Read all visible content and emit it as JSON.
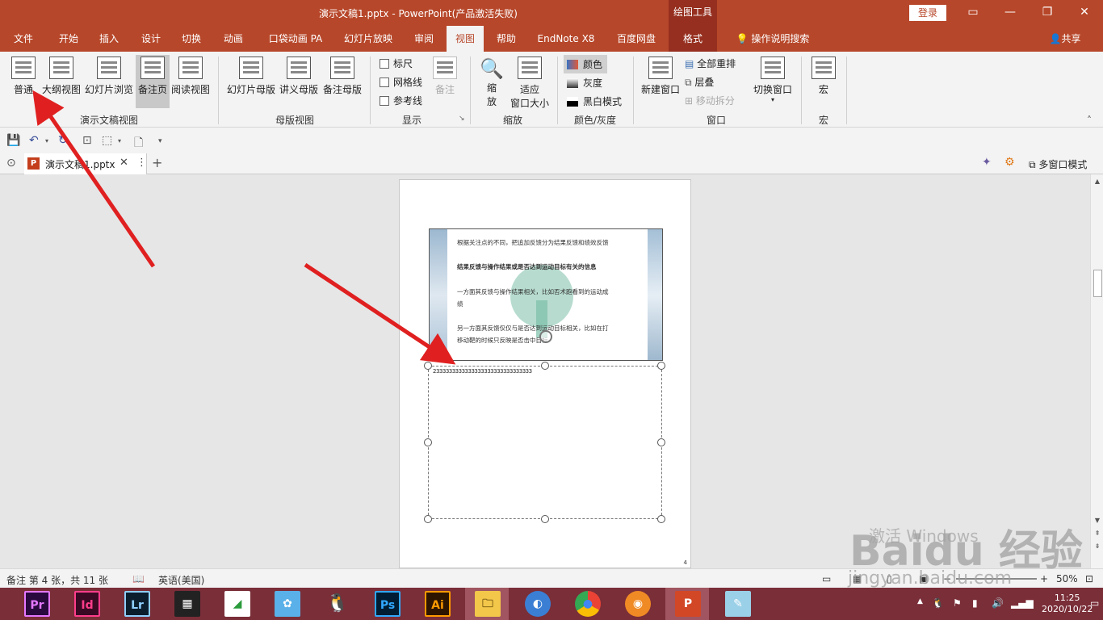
{
  "titlebar": {
    "title": "演示文稿1.pptx  -  PowerPoint(产品激活失败)",
    "drawing_tools": "绘图工具",
    "login": "登录"
  },
  "tabs": [
    "文件",
    "开始",
    "插入",
    "设计",
    "切换",
    "动画",
    "口袋动画 PA",
    "幻灯片放映",
    "审阅",
    "视图",
    "帮助",
    "EndNote X8",
    "百度网盘",
    "格式"
  ],
  "tell_me": "操作说明搜索",
  "share": "共享",
  "ribbon": {
    "pres_views": [
      "普通",
      "大纲视图",
      "幻灯片浏览",
      "备注页",
      "阅读视图"
    ],
    "pres_views_group": "演示文稿视图",
    "master_views": [
      "幻灯片母版",
      "讲义母版",
      "备注母版"
    ],
    "master_group": "母版视图",
    "show": [
      "标尺",
      "网格线",
      "参考线"
    ],
    "notes_btn": "备注",
    "show_group": "显示",
    "zoom_btn": "缩\n放",
    "zoom_l1": "缩",
    "zoom_l2": "放",
    "fit_l1": "适应",
    "fit_l2": "窗口大小",
    "zoom_group": "缩放",
    "color_items": [
      "颜色",
      "灰度",
      "黑白模式"
    ],
    "color_group": "颜色/灰度",
    "new_window": "新建窗口",
    "arrange_all": "全部重排",
    "cascade": "层叠",
    "move_split": "移动拆分",
    "switch_window": "切换窗口",
    "window_group": "窗口",
    "macros": "宏",
    "macros_group": "宏"
  },
  "doc": {
    "tab_name": "演示文稿1.pptx",
    "multiwindow": "多窗口模式"
  },
  "slide": {
    "lines": [
      "根据关注点的不同，把追加反馈分为结果反馈和绩效反馈",
      "结果反馈与操作结果或是否达到运动目标有关的信息",
      "一方面其反馈与操作结果相关，比如否术跑看到的运动成",
      "绩",
      "另一方面其反馈仅仅与是否达到运动目标相关，比如在打",
      "移动靶的时候只反映是否击中目标"
    ],
    "notes_text": "2333333333333333333333333333333",
    "page_number": "4"
  },
  "status": {
    "slide_info": "备注 第 4 张，共 11 张",
    "language": "英语(美国)",
    "zoom": "50%"
  },
  "taskbar": {
    "apps": [
      "Pr",
      "Id",
      "Lr",
      "",
      "",
      "",
      "",
      "Ps",
      "Ai",
      "",
      "",
      "",
      "",
      "P",
      ""
    ],
    "time": "11:25",
    "date": "2020/10/22"
  },
  "watermark": {
    "brand": "Baidu 经验",
    "url": "jingyan.baidu.com",
    "activate": "激活 Windows"
  },
  "colors": {
    "brand": "#b7472a",
    "ribbon_bg": "#f3f3f3",
    "taskbar": "#7a2e38",
    "arrow": "#e02020"
  }
}
